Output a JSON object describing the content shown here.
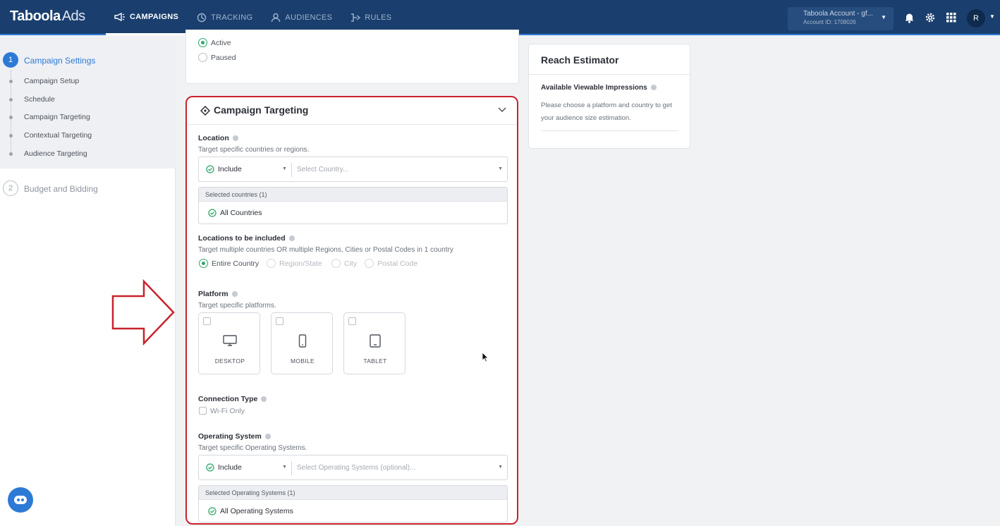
{
  "header": {
    "logo_brand": "Taboola",
    "logo_product": "Ads",
    "nav": [
      {
        "label": "CAMPAIGNS",
        "icon": "megaphone-icon"
      },
      {
        "label": "TRACKING",
        "icon": "pixel-icon"
      },
      {
        "label": "AUDIENCES",
        "icon": "person-icon"
      },
      {
        "label": "RULES",
        "icon": "rules-icon"
      }
    ],
    "account_name": "Taboola Account - gf...",
    "account_id": "Account ID: 1708026",
    "avatar_initial": "R"
  },
  "sidebar": {
    "step1_number": "1",
    "step1_title": "Campaign Settings",
    "step1_items": [
      "Campaign Setup",
      "Schedule",
      "Campaign Targeting",
      "Contextual Targeting",
      "Audience Targeting"
    ],
    "step2_number": "2",
    "step2_title": "Budget and Bidding"
  },
  "status": {
    "options": [
      "Active",
      "Paused"
    ],
    "selected": "Active"
  },
  "targeting": {
    "title": "Campaign Targeting",
    "location": {
      "title": "Location",
      "subtitle": "Target specific countries or regions.",
      "mode": "Include",
      "placeholder": "Select Country...",
      "selected_header": "Selected countries (1)",
      "selected_item": "All Countries"
    },
    "locations_included": {
      "title": "Locations to be included",
      "subtitle": "Target multiple countries OR multiple Regions, Cities or Postal Codes in 1 country",
      "options": [
        "Entire Country",
        "Region/State",
        "City",
        "Postal Code"
      ],
      "selected": "Entire Country"
    },
    "platform": {
      "title": "Platform",
      "subtitle": "Target specific platforms.",
      "tiles": [
        {
          "label": "DESKTOP",
          "icon": "desktop-icon"
        },
        {
          "label": "MOBILE",
          "icon": "mobile-icon"
        },
        {
          "label": "TABLET",
          "icon": "tablet-icon"
        }
      ]
    },
    "connection": {
      "title": "Connection Type",
      "option": "Wi-Fi Only"
    },
    "os": {
      "title": "Operating System",
      "subtitle": "Target specific Operating Systems.",
      "mode": "Include",
      "placeholder": "Select Operating Systems (optional)...",
      "selected_header": "Selected Operating Systems (1)",
      "selected_item": "All Operating Systems"
    }
  },
  "reach": {
    "title": "Reach Estimator",
    "subtitle": "Available Viewable Impressions",
    "description": "Please choose a platform and country to get your audience size estimation."
  },
  "colors": {
    "topbar": "#1a3f6e",
    "accent": "#2d7ad6",
    "success": "#2fa86b",
    "highlight_border": "#c8232c"
  }
}
